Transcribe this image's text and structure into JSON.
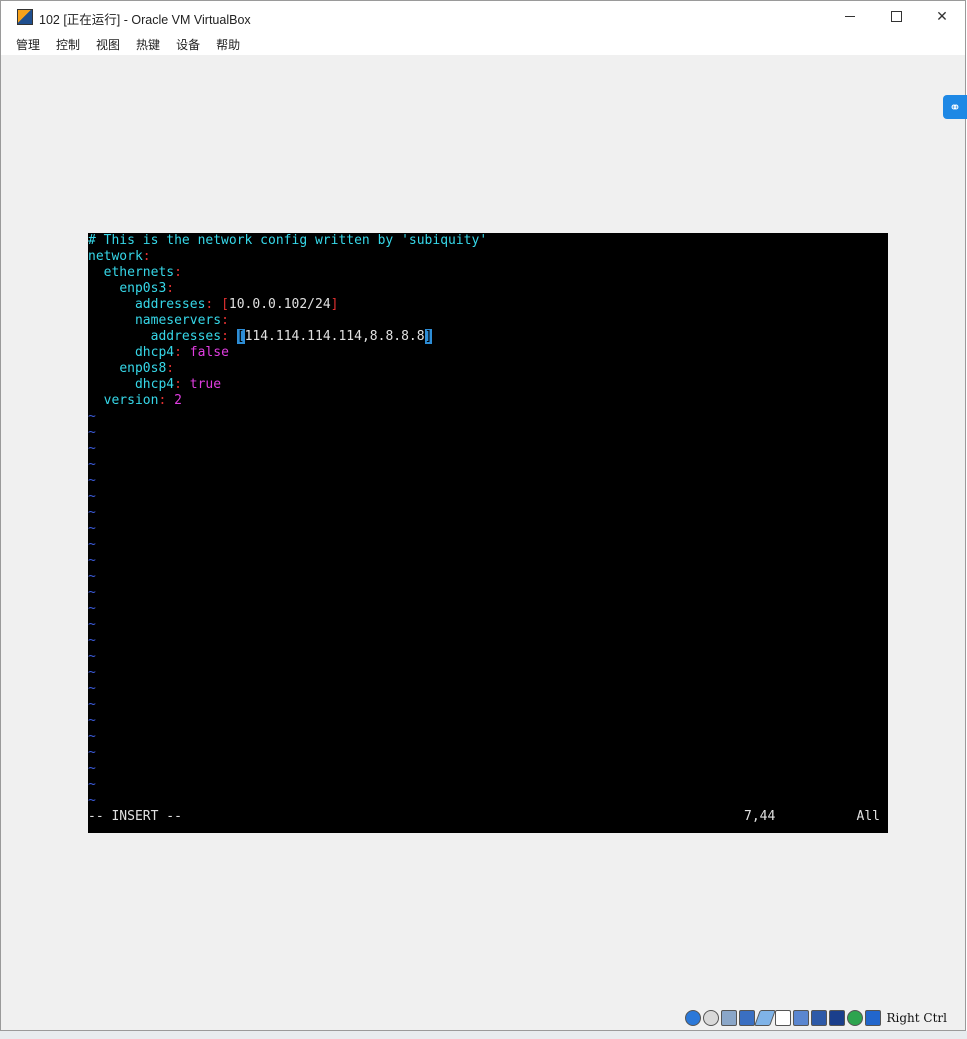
{
  "window": {
    "title": "102 [正在运行] - Oracle VM VirtualBox"
  },
  "menu": [
    "管理",
    "控制",
    "视图",
    "热键",
    "设备",
    "帮助"
  ],
  "editor": {
    "comment": "# This is the network config written by 'subiquity'",
    "l2_key": "network",
    "l3_key": "ethernets",
    "l4_key": "enp0s3",
    "l5_key": "addresses",
    "l5_val": "10.0.0.102/24",
    "l6_key": "nameservers",
    "l7_key": "addresses",
    "l7_val": "114.114.114.114,8.8.8.8",
    "l8_key": "dhcp4",
    "l8_val": "false",
    "l9_key": "enp0s8",
    "l10_key": "dhcp4",
    "l10_val": "true",
    "l11_key": "version",
    "l11_val": "2",
    "tilde": "~",
    "mode": "-- INSERT --",
    "position": "7,44",
    "scroll": "All"
  },
  "statusbar": {
    "host_key": "Right Ctrl"
  }
}
